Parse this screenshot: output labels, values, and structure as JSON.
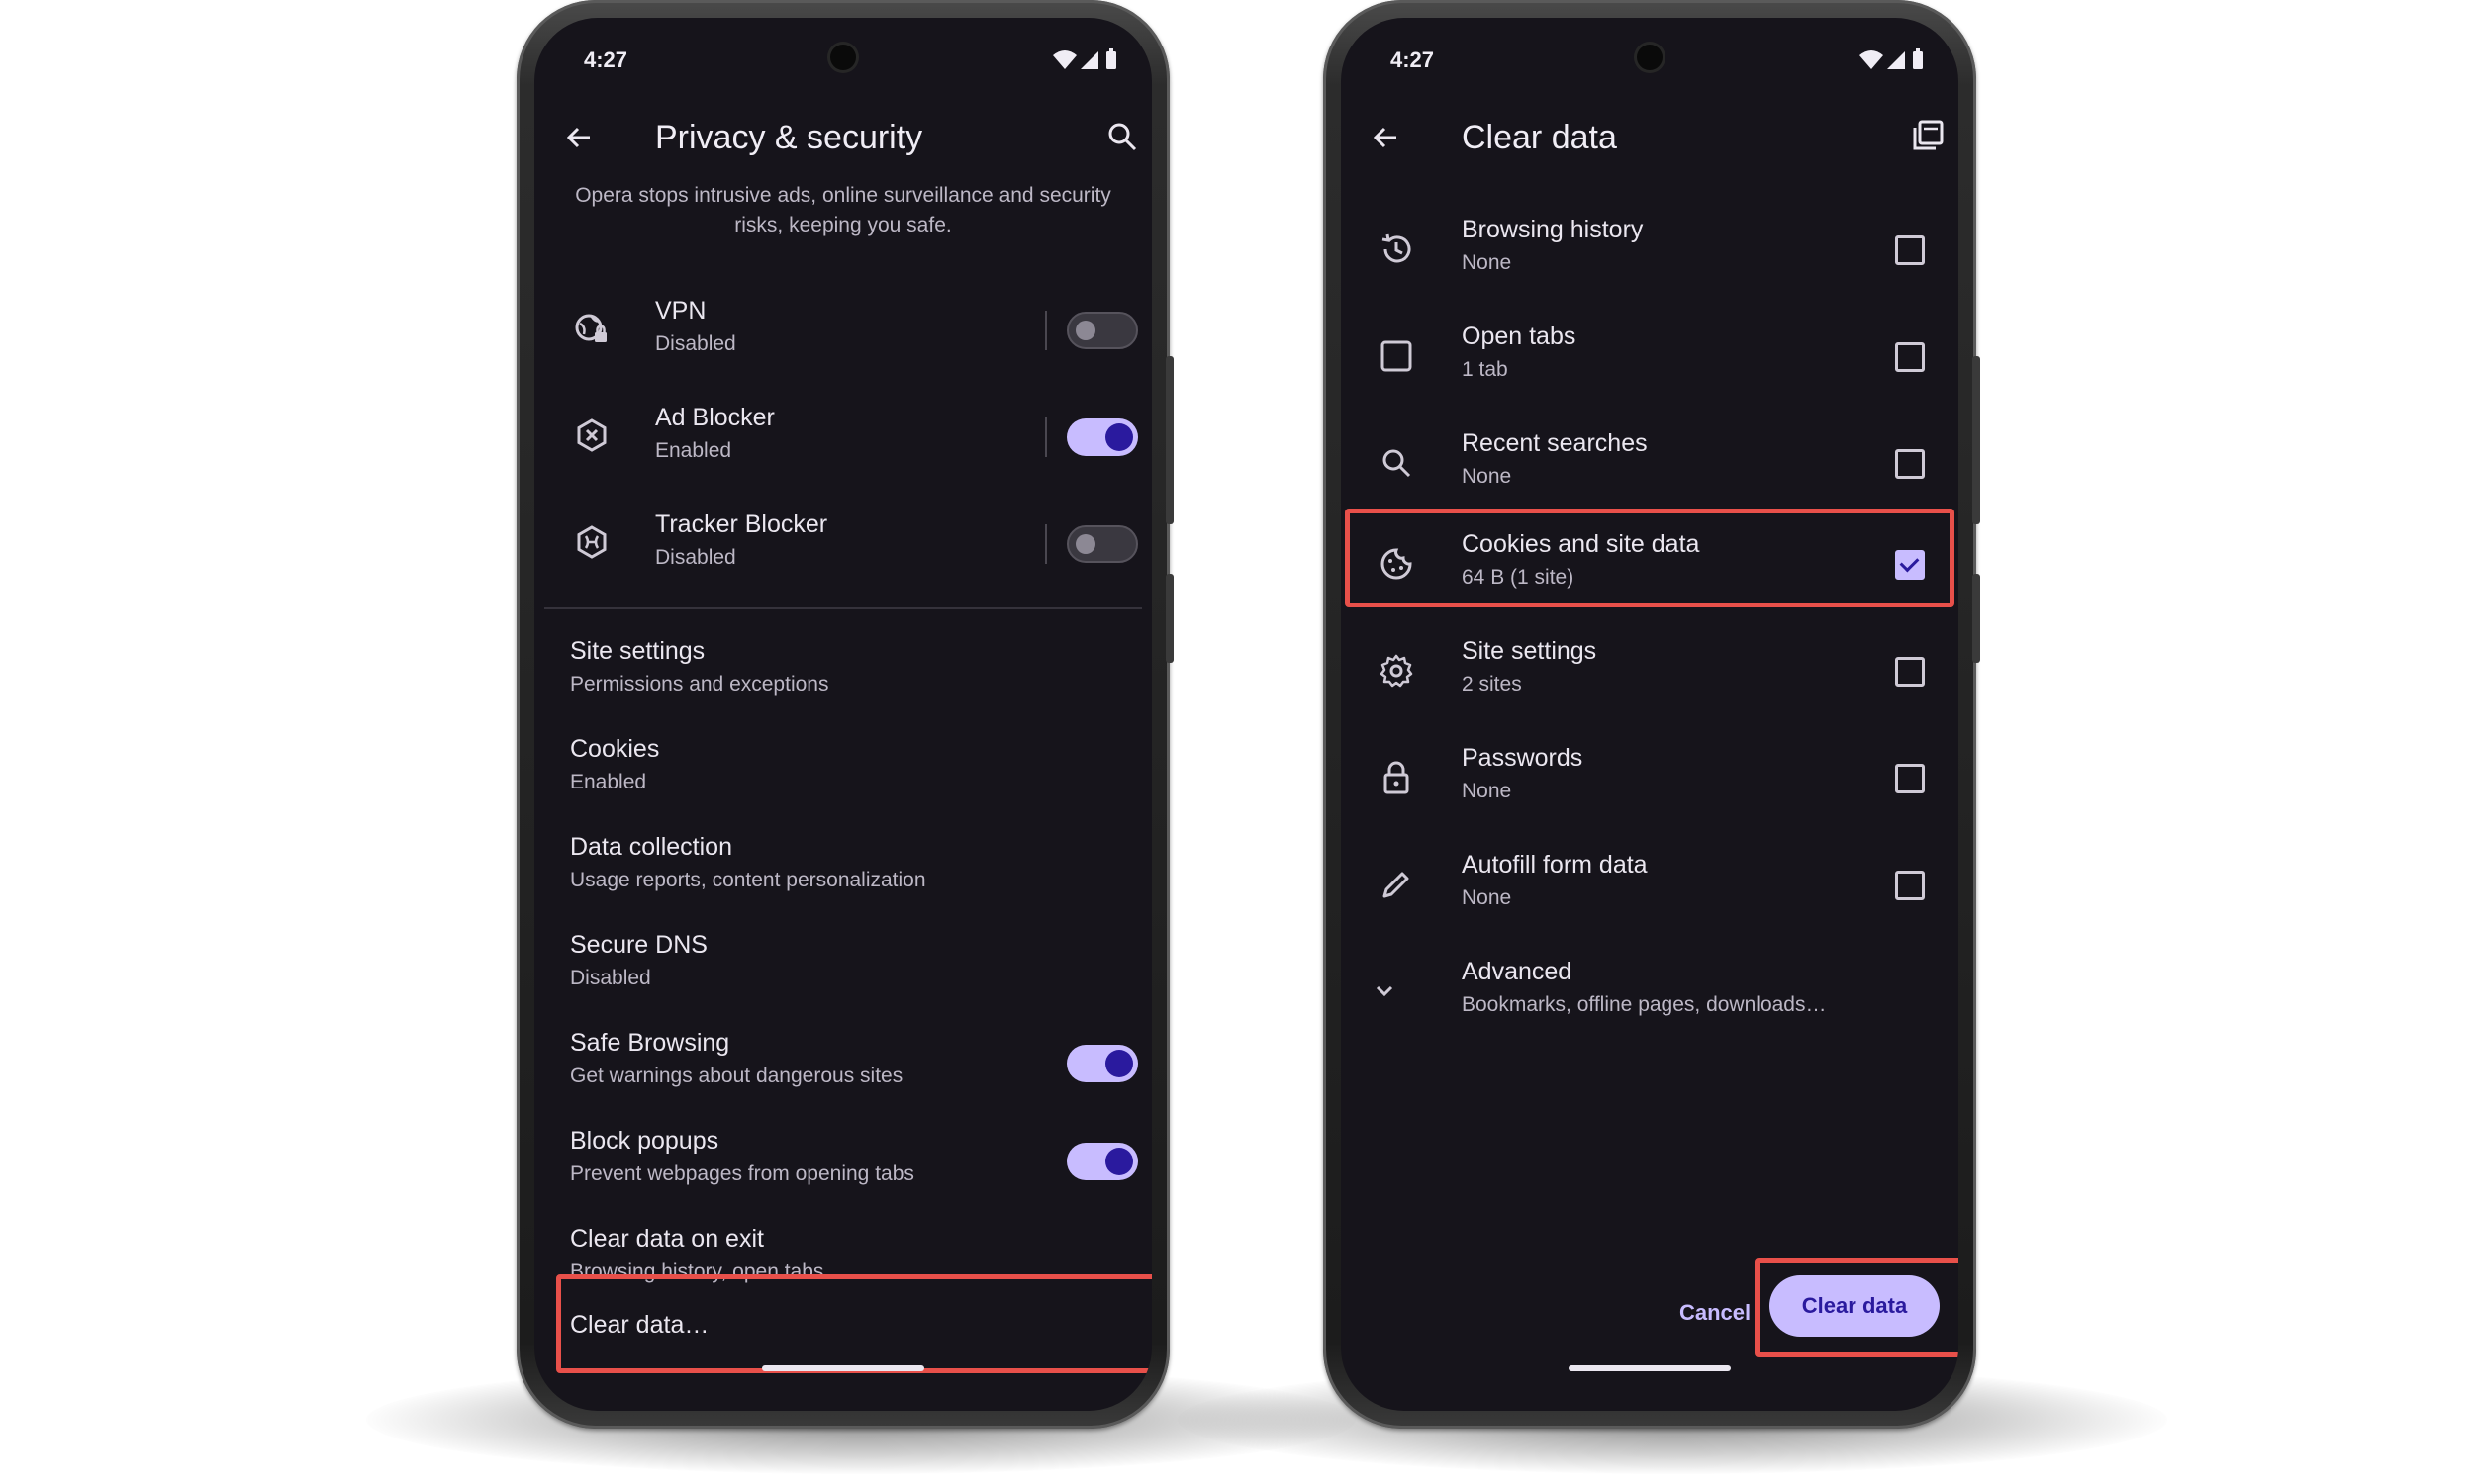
{
  "left_phone": {
    "status": {
      "time": "4:27"
    },
    "toolbar": {
      "title": "Privacy & security"
    },
    "intro": "Opera stops intrusive ads, online surveillance and security risks, keeping you safe.",
    "toggle_rows": [
      {
        "title": "VPN",
        "subtitle": "Disabled",
        "enabled": false,
        "icon": "vpn-globe-lock-icon"
      },
      {
        "title": "Ad Blocker",
        "subtitle": "Enabled",
        "enabled": true,
        "icon": "ad-blocker-hexagon-icon"
      },
      {
        "title": "Tracker Blocker",
        "subtitle": "Disabled",
        "enabled": false,
        "icon": "tracker-blocker-hexagon-icon"
      }
    ],
    "settings": [
      {
        "title": "Site settings",
        "subtitle": "Permissions and exceptions"
      },
      {
        "title": "Cookies",
        "subtitle": "Enabled"
      },
      {
        "title": "Data collection",
        "subtitle": "Usage reports, content personalization"
      },
      {
        "title": "Secure DNS",
        "subtitle": "Disabled"
      },
      {
        "title": "Safe Browsing",
        "subtitle": "Get warnings about dangerous sites",
        "enabled": true
      },
      {
        "title": "Block popups",
        "subtitle": "Prevent webpages from opening tabs",
        "enabled": true
      },
      {
        "title": "Clear data on exit",
        "subtitle": "Browsing history, open tabs"
      }
    ],
    "clear_data_label": "Clear data…"
  },
  "right_phone": {
    "status": {
      "time": "4:27"
    },
    "toolbar": {
      "title": "Clear data"
    },
    "items": [
      {
        "title": "Browsing history",
        "subtitle": "None",
        "checked": false,
        "icon": "history-icon"
      },
      {
        "title": "Open tabs",
        "subtitle": "1 tab",
        "checked": false,
        "icon": "tab-square-icon"
      },
      {
        "title": "Recent searches",
        "subtitle": "None",
        "checked": false,
        "icon": "search-icon"
      },
      {
        "title": "Cookies and site data",
        "subtitle": "64 B (1 site)",
        "checked": true,
        "icon": "cookie-icon"
      },
      {
        "title": "Site settings",
        "subtitle": "2 sites",
        "checked": false,
        "icon": "gear-icon"
      },
      {
        "title": "Passwords",
        "subtitle": "None",
        "checked": false,
        "icon": "lock-icon"
      },
      {
        "title": "Autofill form data",
        "subtitle": "None",
        "checked": false,
        "icon": "pencil-icon"
      }
    ],
    "advanced": {
      "title": "Advanced",
      "subtitle": "Bookmarks, offline pages, downloads…"
    },
    "cancel_label": "Cancel",
    "clear_label": "Clear data"
  },
  "colors": {
    "screen_bg": "#16141b",
    "accent": "#c8bcff",
    "accent_dark": "#2a1a9e",
    "highlight": "#e8504a"
  }
}
